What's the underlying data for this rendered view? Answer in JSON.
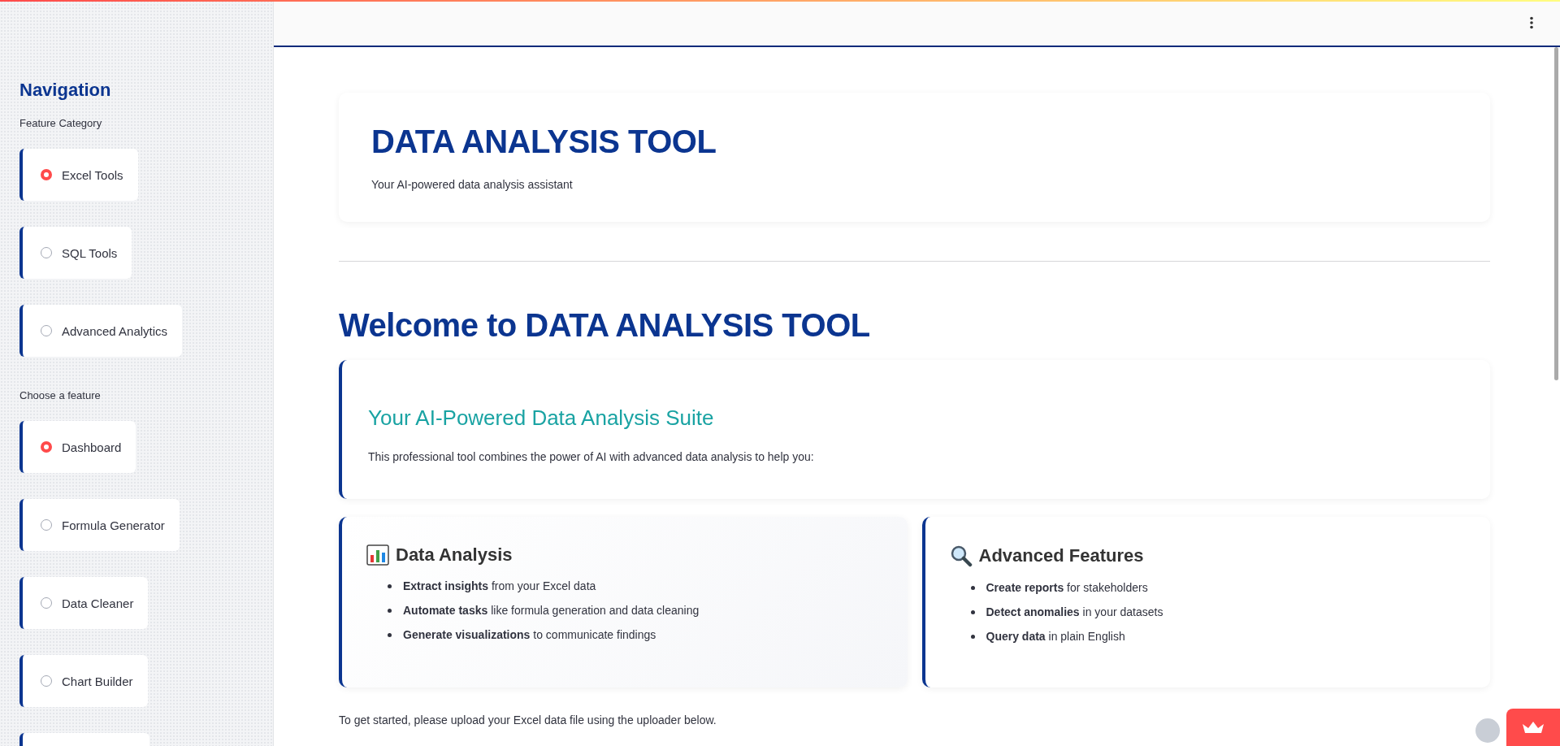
{
  "sidebar": {
    "title": "Navigation",
    "groups": [
      {
        "label": "Feature Category",
        "options": [
          {
            "label": "Excel Tools",
            "selected": true
          },
          {
            "label": "SQL Tools",
            "selected": false
          },
          {
            "label": "Advanced Analytics",
            "selected": false
          }
        ]
      },
      {
        "label": "Choose a feature",
        "options": [
          {
            "label": "Dashboard",
            "selected": true
          },
          {
            "label": "Formula Generator",
            "selected": false
          },
          {
            "label": "Data Cleaner",
            "selected": false
          },
          {
            "label": "Chart Builder",
            "selected": false
          }
        ]
      }
    ]
  },
  "header_card": {
    "title": "DATA ANALYSIS TOOL",
    "subtitle": "Your AI-powered data analysis assistant"
  },
  "welcome": {
    "heading": "Welcome to DATA ANALYSIS TOOL",
    "card": {
      "title": "Your AI-Powered Data Analysis Suite",
      "text": "This professional tool combines the power of AI with advanced data analysis to help you:"
    }
  },
  "features": [
    {
      "kind": "chart",
      "title": "Data Analysis",
      "items": [
        "**Extract insights** from your Excel data",
        "**Automate tasks** like formula generation and data cleaning",
        "**Generate visualizations** to communicate findings"
      ]
    },
    {
      "kind": "search",
      "title": "Advanced Features",
      "items": [
        "**Create reports** for stakeholders",
        "**Detect anomalies** in your datasets",
        "**Query data** in plain English"
      ]
    }
  ],
  "footer_text": "To get started, please upload your Excel data file using the uploader below."
}
